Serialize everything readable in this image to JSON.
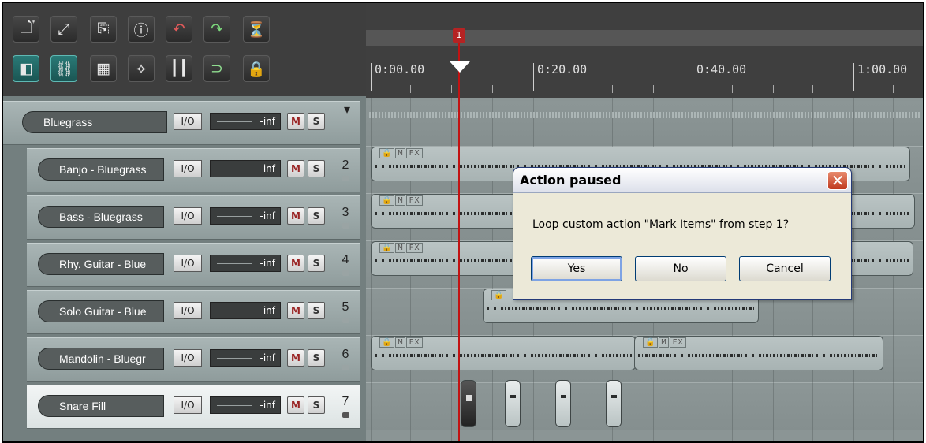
{
  "toolbar": {
    "row1": [
      "new-project-icon",
      "open-project-icon",
      "save-project-icon",
      "project-info-icon",
      "undo-icon",
      "redo-icon",
      "metronome-icon"
    ],
    "row2": [
      "item-grouping-icon",
      "ripple-edit-icon",
      "snap-icon",
      "envelope-icon",
      "grid-icon",
      "loop-icon",
      "lock-icon"
    ],
    "glyph_row1": [
      "🗋",
      "⤢",
      "⎘",
      "ⓘ",
      "↶",
      "↷",
      "⏳"
    ],
    "glyph_row2": [
      "◧",
      "⛓",
      "▦",
      "⟡",
      "┃┃",
      "⊃",
      "🔒"
    ]
  },
  "tracks": [
    {
      "name": "Bluegrass",
      "io": "I/O",
      "vol": "-inf",
      "m": "M",
      "s": "S",
      "num": ""
    },
    {
      "name": "Banjo - Bluegrass",
      "io": "I/O",
      "vol": "-inf",
      "m": "M",
      "s": "S",
      "num": "2"
    },
    {
      "name": "Bass - Bluegrass",
      "io": "I/O",
      "vol": "-inf",
      "m": "M",
      "s": "S",
      "num": "3"
    },
    {
      "name": "Rhy. Guitar - Blue",
      "io": "I/O",
      "vol": "-inf",
      "m": "M",
      "s": "S",
      "num": "4"
    },
    {
      "name": "Solo Guitar - Blue",
      "io": "I/O",
      "vol": "-inf",
      "m": "M",
      "s": "S",
      "num": "5"
    },
    {
      "name": "Mandolin - Bluegr",
      "io": "I/O",
      "vol": "-inf",
      "m": "M",
      "s": "S",
      "num": "6"
    },
    {
      "name": "Snare Fill",
      "io": "I/O",
      "vol": "-inf",
      "m": "M",
      "s": "S",
      "num": "7"
    }
  ],
  "ruler": {
    "labels": [
      "0:00.00",
      "0:20.00",
      "0:40.00",
      "1:00.00"
    ],
    "marker": "1"
  },
  "item_icons": {
    "lock": "🔒",
    "m": "M",
    "fx": "FX"
  },
  "dialog": {
    "title": "Action paused",
    "message": "Loop custom action \"Mark Items\" from step 1?",
    "buttons": {
      "yes": "Yes",
      "no": "No",
      "cancel": "Cancel"
    },
    "close": "✕"
  }
}
